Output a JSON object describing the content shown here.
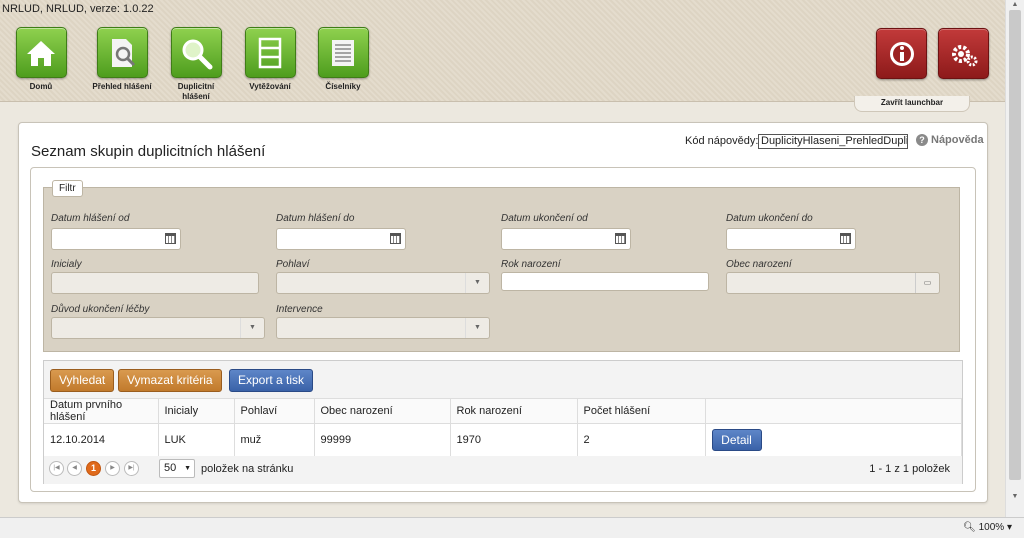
{
  "app": {
    "title": "NRLUD, NRLUD, verze: 1.0.22"
  },
  "launchbar": {
    "items": [
      {
        "label": "Domů",
        "icon": "home-icon"
      },
      {
        "label": "Přehled hlášení",
        "icon": "report-search-icon"
      },
      {
        "label": "Duplicitní hlášení",
        "icon": "magnifier-icon"
      },
      {
        "label": "Vytěžování",
        "icon": "database-icon"
      },
      {
        "label": "Číselníky",
        "icon": "codelist-icon"
      }
    ],
    "info_icon": "info-icon",
    "settings_icon": "gear-icon",
    "close_label": "Zavřít launchbar",
    "tile_color": "#5aa823",
    "tile_red": "#a82626"
  },
  "page": {
    "title": "Seznam skupin duplicitních hlášení",
    "help_label": "Kód nápovědy:",
    "help_code": "DuplicityHlaseni_PrehledDuplicit",
    "help_link": "Nápověda"
  },
  "filter": {
    "tab": "Filtr",
    "fields": {
      "datum_od": "Datum hlášení od",
      "datum_do": "Datum hlášení do",
      "ukonceni_od": "Datum ukončení od",
      "ukonceni_do": "Datum ukončení do",
      "inicialy": "Inicialy",
      "pohlavi": "Pohlaví",
      "rok": "Rok narození",
      "obec": "Obec narození",
      "duvod": "Důvod ukončení léčby",
      "intervence": "Intervence"
    }
  },
  "toolbar": {
    "search": "Vyhledat",
    "clear": "Vymazat kritéria",
    "export": "Export a tisk"
  },
  "table": {
    "columns": [
      "Datum prvního hlášení",
      "Inicialy",
      "Pohlaví",
      "Obec narození",
      "Rok narození",
      "Počet hlášení"
    ],
    "rows": [
      {
        "datum": "12.10.2014",
        "inicialy": "LUK",
        "pohlavi": "muž",
        "obec": "99999",
        "rok": "1970",
        "pocet": "2",
        "action": "Detail"
      }
    ]
  },
  "pager": {
    "current_page": "1",
    "per_page": "50",
    "per_page_label": "položek na stránku",
    "info": "1 - 1 z 1 položek"
  },
  "status": {
    "zoom": "100%"
  }
}
